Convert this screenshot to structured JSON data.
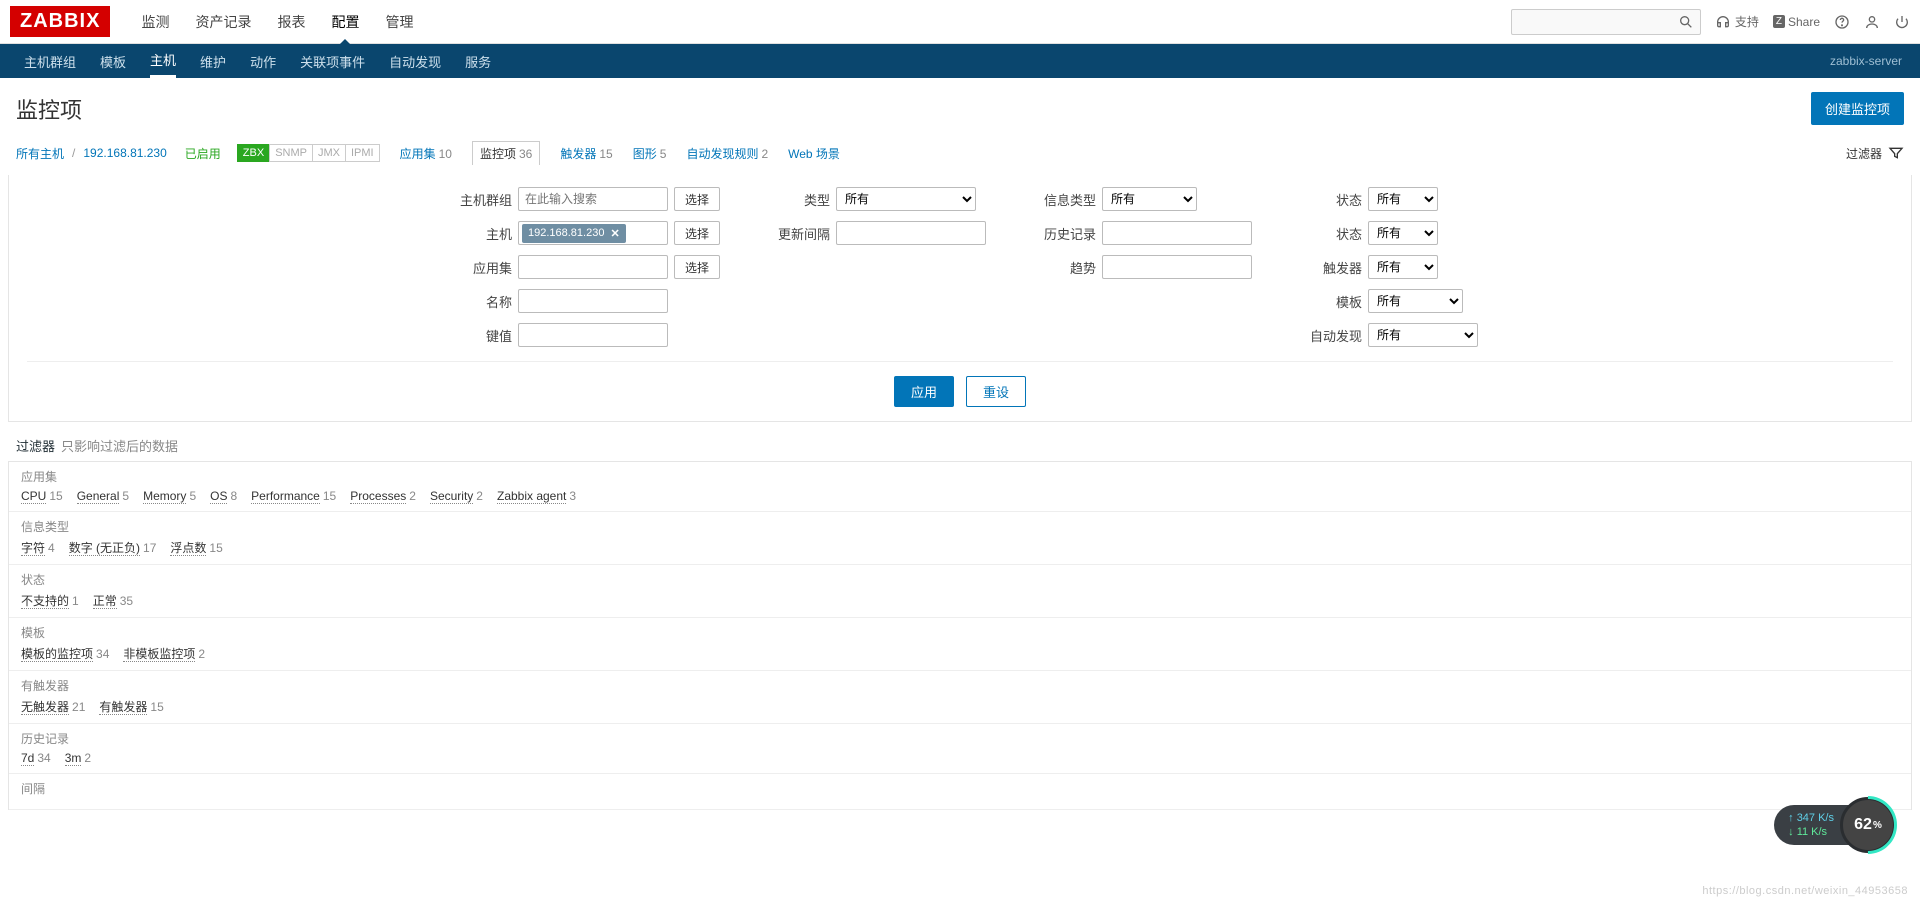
{
  "topnav": [
    "监测",
    "资产记录",
    "报表",
    "配置",
    "管理"
  ],
  "topnav_active": 3,
  "top_right": {
    "support": "支持",
    "share": "Share"
  },
  "subnav": [
    "主机群组",
    "模板",
    "主机",
    "维护",
    "动作",
    "关联项事件",
    "自动发现",
    "服务"
  ],
  "subnav_active": 2,
  "server": "zabbix-server",
  "page_title": "监控项",
  "create_btn": "创建监控项",
  "crumbs": {
    "all_hosts": "所有主机",
    "host_ip": "192.168.81.230",
    "enabled": "已启用",
    "zbx": "ZBX",
    "protocols": [
      "SNMP",
      "JMX",
      "IPMI"
    ],
    "tabs": [
      {
        "label": "应用集",
        "count": 10
      },
      {
        "label": "监控项",
        "count": 36,
        "active": true
      },
      {
        "label": "触发器",
        "count": 15
      },
      {
        "label": "图形",
        "count": 5
      },
      {
        "label": "自动发现规则",
        "count": 2
      },
      {
        "label": "Web 场景",
        "count": ""
      }
    ],
    "filter_label": "过滤器"
  },
  "filter": {
    "labels": {
      "hostgroup": "主机群组",
      "host": "主机",
      "appset": "应用集",
      "name": "名称",
      "key": "键值",
      "type": "类型",
      "interval": "更新间隔",
      "history": "历史记录",
      "trend": "趋势",
      "infotype": "信息类型",
      "state": "状态",
      "status": "状态",
      "trigger": "触发器",
      "template": "模板",
      "discovery": "自动发现"
    },
    "placeholder": "在此输入搜索",
    "select_btn": "选择",
    "tag": "192.168.81.230",
    "opt_all": "所有",
    "apply": "应用",
    "reset": "重设"
  },
  "subfilter": {
    "heading": "过滤器",
    "hint": "只影响过滤后的数据",
    "sections": [
      {
        "label": "应用集",
        "items": [
          {
            "name": "CPU",
            "count": 15
          },
          {
            "name": "General",
            "count": 5
          },
          {
            "name": "Memory",
            "count": 5
          },
          {
            "name": "OS",
            "count": 8
          },
          {
            "name": "Performance",
            "count": 15
          },
          {
            "name": "Processes",
            "count": 2
          },
          {
            "name": "Security",
            "count": 2
          },
          {
            "name": "Zabbix agent",
            "count": 3
          }
        ]
      },
      {
        "label": "信息类型",
        "items": [
          {
            "name": "字符",
            "count": 4
          },
          {
            "name": "数字 (无正负)",
            "count": 17
          },
          {
            "name": "浮点数",
            "count": 15
          }
        ]
      },
      {
        "label": "状态",
        "items": [
          {
            "name": "不支持的",
            "count": 1
          },
          {
            "name": "正常",
            "count": 35
          }
        ]
      },
      {
        "label": "模板",
        "items": [
          {
            "name": "模板的监控项",
            "count": 34
          },
          {
            "name": "非模板监控项",
            "count": 2
          }
        ]
      },
      {
        "label": "有触发器",
        "items": [
          {
            "name": "无触发器",
            "count": 21
          },
          {
            "name": "有触发器",
            "count": 15
          }
        ]
      },
      {
        "label": "历史记录",
        "items": [
          {
            "name": "7d",
            "count": 34
          },
          {
            "name": "3m",
            "count": 2
          }
        ]
      },
      {
        "label": "间隔",
        "items": []
      }
    ]
  },
  "overlay": {
    "up": "347 K/s",
    "down": "11 K/s",
    "pct": "62",
    "pct_sfx": "%"
  },
  "watermark": "https://blog.csdn.net/weixin_44953658"
}
